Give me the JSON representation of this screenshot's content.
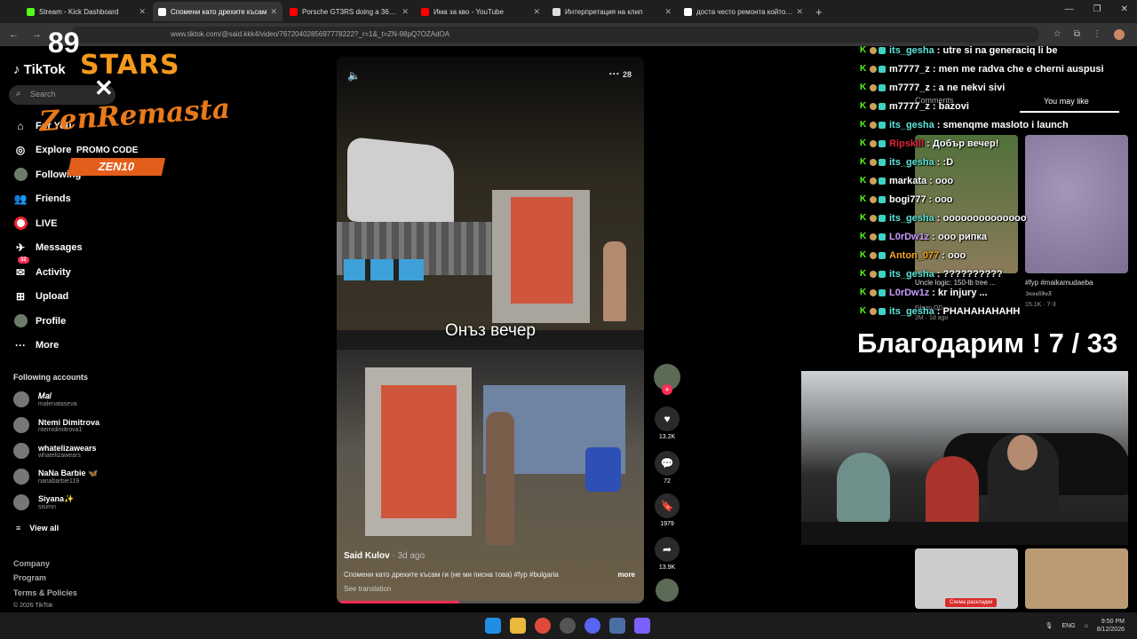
{
  "browser": {
    "tabs": [
      {
        "label": "Stream - Kick Dashboard",
        "color": "#53fc18",
        "active": false
      },
      {
        "label": "Спомени като дрехите късам",
        "color": "#ffffff",
        "active": true
      },
      {
        "label": "Porsche GT3RS doing a 360 - Yo",
        "color": "#ff0000",
        "active": false
      },
      {
        "label": "Има за кво - YouTube",
        "color": "#ff0000",
        "active": false
      },
      {
        "label": "Интерпретация на клип",
        "color": "#dddddd",
        "active": false
      },
      {
        "label": "доста често ремонта който се",
        "color": "#ffffff",
        "active": false
      }
    ],
    "url": "www.tiktok.com/@said.kkk4/video/7672040285697778222?_r=1&_t=ZN-98pQ7OZAdOA"
  },
  "sponsor": {
    "brand_num": "89",
    "brand_word": "STARS",
    "cross": "✕",
    "partner": "ZenRemasta",
    "promo_label": "PROMO CODE",
    "promo_code": "ZEN10"
  },
  "tiktok": {
    "logo": "TikTok",
    "search_placeholder": "Search",
    "nav": [
      {
        "label": "For You",
        "icon": "home-icon"
      },
      {
        "label": "Explore",
        "icon": "compass-icon"
      },
      {
        "label": "Following",
        "icon": "following-icon"
      },
      {
        "label": "Friends",
        "icon": "friends-icon"
      },
      {
        "label": "LIVE",
        "icon": "live-icon"
      },
      {
        "label": "Messages",
        "icon": "send-icon"
      },
      {
        "label": "Activity",
        "icon": "activity-icon",
        "badge": "32"
      },
      {
        "label": "Upload",
        "icon": "upload-icon"
      },
      {
        "label": "Profile",
        "icon": "profile-icon"
      },
      {
        "label": "More",
        "icon": "more-icon"
      }
    ],
    "following_title": "Following accounts",
    "accounts": [
      {
        "name": "𝑀𝑎𝑙",
        "handle": "malenataseva"
      },
      {
        "name": "Ntemi Dimitrova",
        "handle": "ntemidimitrova1"
      },
      {
        "name": "whatelizawears",
        "handle": "whatelizawears"
      },
      {
        "name": "NaNa Barbie 🦋",
        "handle": "nanabarbie119"
      },
      {
        "name": "Siyana✨",
        "handle": "sisimn"
      }
    ],
    "view_all": "View all",
    "footer": [
      "Company",
      "Program",
      "Terms & Policies",
      "© 2026 TikTok"
    ]
  },
  "video": {
    "caption_overlay": "Онъз вечер",
    "author": "Said Kulov",
    "posted": "· 3d ago",
    "description": "Спомени като дрехите къcам ги (не ми писна това) #fyp #bulgaria",
    "more": "more",
    "see_translation": "See translation",
    "top_right_number": "28",
    "progress": 0.4
  },
  "actions": {
    "likes": "13.2K",
    "comments": "72",
    "saves": "1979",
    "shares": "13.9K"
  },
  "right_panel": {
    "tab_comments": "Comments",
    "tab_you_may_like": "You may like",
    "thumb1_title": "Uncle logic: 150-lb tree ...",
    "thumb1_author": "Filean OD",
    "thumb1_meta": "2M · 1d ago",
    "thumb2_title": "#fyp #maikamudaeba",
    "thumb2_author": "𝕴𝖓𝖛𝖆𝖑𝖎𝖉𝖆𝖃",
    "thumb2_meta": "15.1K · 7-3",
    "schema_label": "Схема раскладки"
  },
  "chat": [
    {
      "user": "its_gesha",
      "color": "#5ee6d8",
      "msg": "utre si na generaciq li be"
    },
    {
      "user": "m7777_z",
      "color": "#ffffff",
      "msg": "men me radva che e cherni auspusi"
    },
    {
      "user": "m7777_z",
      "color": "#ffffff",
      "msg": "a ne nekvi sivi"
    },
    {
      "user": "m7777_z",
      "color": "#ffffff",
      "msg": "bazovi"
    },
    {
      "user": "its_gesha",
      "color": "#5ee6d8",
      "msg": "smenqme masloto i launch"
    },
    {
      "user": "Ripskill",
      "color": "#e0243a",
      "msg": "Добър вечер!"
    },
    {
      "user": "its_gesha",
      "color": "#5ee6d8",
      "msg": ":D"
    },
    {
      "user": "markata",
      "color": "#ffffff",
      "msg": "ооо"
    },
    {
      "user": "bogi777",
      "color": "#ffffff",
      "msg": "ооо"
    },
    {
      "user": "its_gesha",
      "color": "#5ee6d8",
      "msg": "oooooooooooooo"
    },
    {
      "user": "L0rDw1z",
      "color": "#c79cff",
      "msg": "ооо рипка"
    },
    {
      "user": "Anton_077",
      "color": "#f5a623",
      "msg": "ооо"
    },
    {
      "user": "its_gesha",
      "color": "#5ee6d8",
      "msg": "??????????"
    },
    {
      "user": "L0rDw1z",
      "color": "#c79cff",
      "msg": "kr injury ..."
    },
    {
      "user": "its_gesha",
      "color": "#5ee6d8",
      "msg": "PHAHAHAHAHH"
    }
  ],
  "thanks_banner": "Благодарим ! 7 / 33",
  "taskbar": {
    "lang": "ENG",
    "time": "9:50 PM",
    "date": "8/12/2026"
  }
}
